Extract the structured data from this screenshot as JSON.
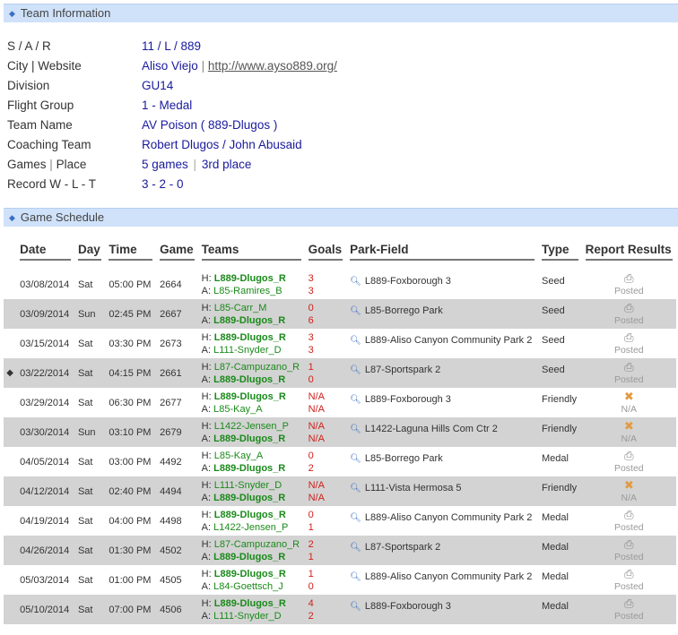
{
  "team_info": {
    "header": "Team Information",
    "rows": [
      {
        "label": "S / A / R",
        "value": "11 / L / 889"
      },
      {
        "label": "City | Website",
        "city": "Aliso Viejo",
        "website": "http://www.ayso889.org/"
      },
      {
        "label": "Division",
        "value": "GU14"
      },
      {
        "label": "Flight Group",
        "value": "1 - Medal"
      },
      {
        "label": "Team Name",
        "value": "AV Poison ( 889-Dlugos )"
      },
      {
        "label": "Coaching Team",
        "value": "Robert Dlugos / John Abusaid"
      },
      {
        "label": "Games",
        "label2": "Place",
        "games": "5 games",
        "place": "3rd place"
      },
      {
        "label": "Record W - L - T",
        "value": "3 - 2 - 0"
      }
    ]
  },
  "schedule": {
    "header": "Game Schedule",
    "columns": [
      "Date",
      "Day",
      "Time",
      "Game",
      "Teams",
      "Goals",
      "Park-Field",
      "Type",
      "Report Results"
    ],
    "rows": [
      {
        "date": "03/08/2014",
        "day": "Sat",
        "time": "05:00 PM",
        "game": "2664",
        "home": "L889-Dlugos_R",
        "away": "L85-Ramires_B",
        "hg": "3",
        "ag": "3",
        "park": "L889-Foxborough 3",
        "type": "Seed",
        "result": "Posted",
        "result_icon": "printer-icon",
        "marked": false
      },
      {
        "date": "03/09/2014",
        "day": "Sun",
        "time": "02:45 PM",
        "game": "2667",
        "home": "L85-Carr_M",
        "away": "L889-Dlugos_R",
        "hg": "0",
        "ag": "6",
        "park": "L85-Borrego Park",
        "type": "Seed",
        "result": "Posted",
        "result_icon": "printer-icon",
        "marked": false
      },
      {
        "date": "03/15/2014",
        "day": "Sat",
        "time": "03:30 PM",
        "game": "2673",
        "home": "L889-Dlugos_R",
        "away": "L111-Snyder_D",
        "hg": "3",
        "ag": "3",
        "park": "L889-Aliso Canyon Community Park 2",
        "type": "Seed",
        "result": "Posted",
        "result_icon": "printer-icon",
        "marked": false
      },
      {
        "date": "03/22/2014",
        "day": "Sat",
        "time": "04:15 PM",
        "game": "2661",
        "home": "L87-Campuzano_R",
        "away": "L889-Dlugos_R",
        "hg": "1",
        "ag": "0",
        "park": "L87-Sportspark 2",
        "type": "Seed",
        "result": "Posted",
        "result_icon": "printer-icon",
        "marked": true
      },
      {
        "date": "03/29/2014",
        "day": "Sat",
        "time": "06:30 PM",
        "game": "2677",
        "home": "L889-Dlugos_R",
        "away": "L85-Kay_A",
        "hg": "N/A",
        "ag": "N/A",
        "park": "L889-Foxborough 3",
        "type": "Friendly",
        "result": "N/A",
        "result_icon": "cross-icon",
        "marked": false
      },
      {
        "date": "03/30/2014",
        "day": "Sun",
        "time": "03:10 PM",
        "game": "2679",
        "home": "L1422-Jensen_P",
        "away": "L889-Dlugos_R",
        "hg": "N/A",
        "ag": "N/A",
        "park": "L1422-Laguna Hills Com Ctr 2",
        "type": "Friendly",
        "result": "N/A",
        "result_icon": "cross-icon",
        "marked": false
      },
      {
        "date": "04/05/2014",
        "day": "Sat",
        "time": "03:00 PM",
        "game": "4492",
        "home": "L85-Kay_A",
        "away": "L889-Dlugos_R",
        "hg": "0",
        "ag": "2",
        "park": "L85-Borrego Park",
        "type": "Medal",
        "result": "Posted",
        "result_icon": "printer-icon",
        "marked": false
      },
      {
        "date": "04/12/2014",
        "day": "Sat",
        "time": "02:40 PM",
        "game": "4494",
        "home": "L111-Snyder_D",
        "away": "L889-Dlugos_R",
        "hg": "N/A",
        "ag": "N/A",
        "park": "L111-Vista Hermosa 5",
        "type": "Friendly",
        "result": "N/A",
        "result_icon": "cross-icon",
        "marked": false
      },
      {
        "date": "04/19/2014",
        "day": "Sat",
        "time": "04:00 PM",
        "game": "4498",
        "home": "L889-Dlugos_R",
        "away": "L1422-Jensen_P",
        "hg": "0",
        "ag": "1",
        "park": "L889-Aliso Canyon Community Park 2",
        "type": "Medal",
        "result": "Posted",
        "result_icon": "printer-icon",
        "marked": false
      },
      {
        "date": "04/26/2014",
        "day": "Sat",
        "time": "01:30 PM",
        "game": "4502",
        "home": "L87-Campuzano_R",
        "away": "L889-Dlugos_R",
        "hg": "2",
        "ag": "1",
        "park": "L87-Sportspark 2",
        "type": "Medal",
        "result": "Posted",
        "result_icon": "printer-icon",
        "marked": false
      },
      {
        "date": "05/03/2014",
        "day": "Sat",
        "time": "01:00 PM",
        "game": "4505",
        "home": "L889-Dlugos_R",
        "away": "L84-Goettsch_J",
        "hg": "1",
        "ag": "0",
        "park": "L889-Aliso Canyon Community Park 2",
        "type": "Medal",
        "result": "Posted",
        "result_icon": "printer-icon",
        "marked": false
      },
      {
        "date": "05/10/2014",
        "day": "Sat",
        "time": "07:00 PM",
        "game": "4506",
        "home": "L889-Dlugos_R",
        "away": "L111-Snyder_D",
        "hg": "4",
        "ag": "2",
        "park": "L889-Foxborough 3",
        "type": "Medal",
        "result": "Posted",
        "result_icon": "printer-icon",
        "marked": false
      }
    ]
  },
  "labels": {
    "home_prefix": "H:",
    "away_prefix": "A:",
    "own_team": "L889-Dlugos_R"
  },
  "icons": {
    "section_bullet": "diamond-bullet-icon",
    "park_search": "magnifier-icon",
    "game_marker": "red-diamond-icon"
  },
  "colors": {
    "section_bar": "#cfe2fa",
    "alt_row": "#d3d3d3",
    "team_green": "#1a8a1a",
    "goal_red": "#d0201b",
    "value_blue": "#1a1a9e"
  }
}
